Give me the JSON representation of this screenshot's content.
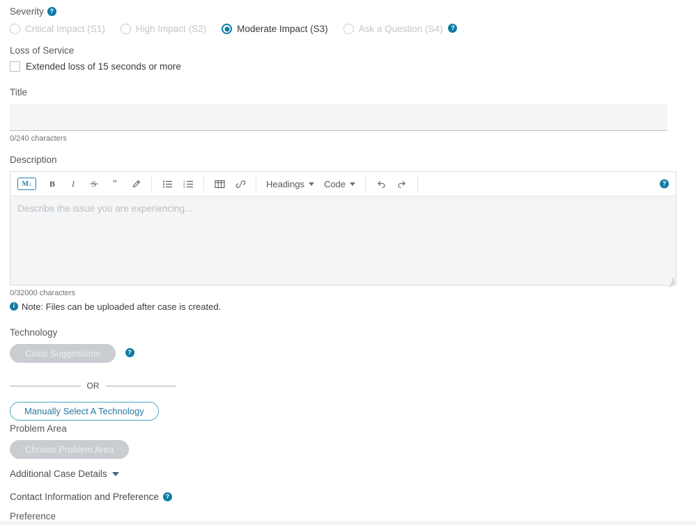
{
  "severity": {
    "label": "Severity",
    "help_icon": "help-icon",
    "options": [
      {
        "label": "Critical Impact (S1)",
        "selected": false
      },
      {
        "label": "High Impact (S2)",
        "selected": false
      },
      {
        "label": "Moderate Impact (S3)",
        "selected": true
      },
      {
        "label": "Ask a Question (S4)",
        "selected": false
      }
    ]
  },
  "loss_of_service": {
    "label": "Loss of Service",
    "checkbox_label": "Extended loss of 15 seconds or more",
    "checked": false
  },
  "title": {
    "label": "Title",
    "value": "",
    "placeholder": "",
    "char_count": "0/240 characters"
  },
  "description": {
    "label": "Description",
    "placeholder": "Describe the issue you are experiencing...",
    "value": "",
    "char_count": "0/32000 characters",
    "note": "Note: Files can be uploaded after case is created.",
    "toolbar": {
      "markdown_badge": "M",
      "buttons": [
        {
          "name": "markdown-toggle",
          "icon": "markdown-icon",
          "label": "M"
        },
        {
          "name": "bold",
          "icon": "bold-icon",
          "label": "B"
        },
        {
          "name": "italic",
          "icon": "italic-icon",
          "label": "I"
        },
        {
          "name": "strikethrough",
          "icon": "strikethrough-icon",
          "label": "S"
        },
        {
          "name": "blockquote",
          "icon": "quote-icon",
          "label": "“"
        },
        {
          "name": "highlight",
          "icon": "highlighter-icon",
          "label": ""
        },
        {
          "name": "bulleted-list",
          "icon": "bulleted-list-icon",
          "label": ""
        },
        {
          "name": "numbered-list",
          "icon": "numbered-list-icon",
          "label": ""
        },
        {
          "name": "table",
          "icon": "table-icon",
          "label": ""
        },
        {
          "name": "link",
          "icon": "link-icon",
          "label": ""
        },
        {
          "name": "undo",
          "icon": "undo-icon",
          "label": ""
        },
        {
          "name": "redo",
          "icon": "redo-icon",
          "label": ""
        }
      ],
      "headings_dropdown": "Headings",
      "code_dropdown": "Code"
    }
  },
  "technology": {
    "label": "Technology",
    "suggestions_button": "Cisco Suggestions",
    "or_text": "OR",
    "manual_button": "Manually Select A Technology"
  },
  "problem_area": {
    "label": "Problem Area",
    "button": "Choose Problem Area"
  },
  "additional_case_details": {
    "label": "Additional Case Details"
  },
  "contact": {
    "heading": "Contact Information and Preference",
    "preference_label": "Preference"
  },
  "colors": {
    "accent": "#0d7ba5",
    "link": "#2878a0",
    "disabled_pill": "#c9ccd1",
    "input_bg": "#f4f5f6",
    "text": "#58585b",
    "muted_text": "#c3c5c7"
  }
}
